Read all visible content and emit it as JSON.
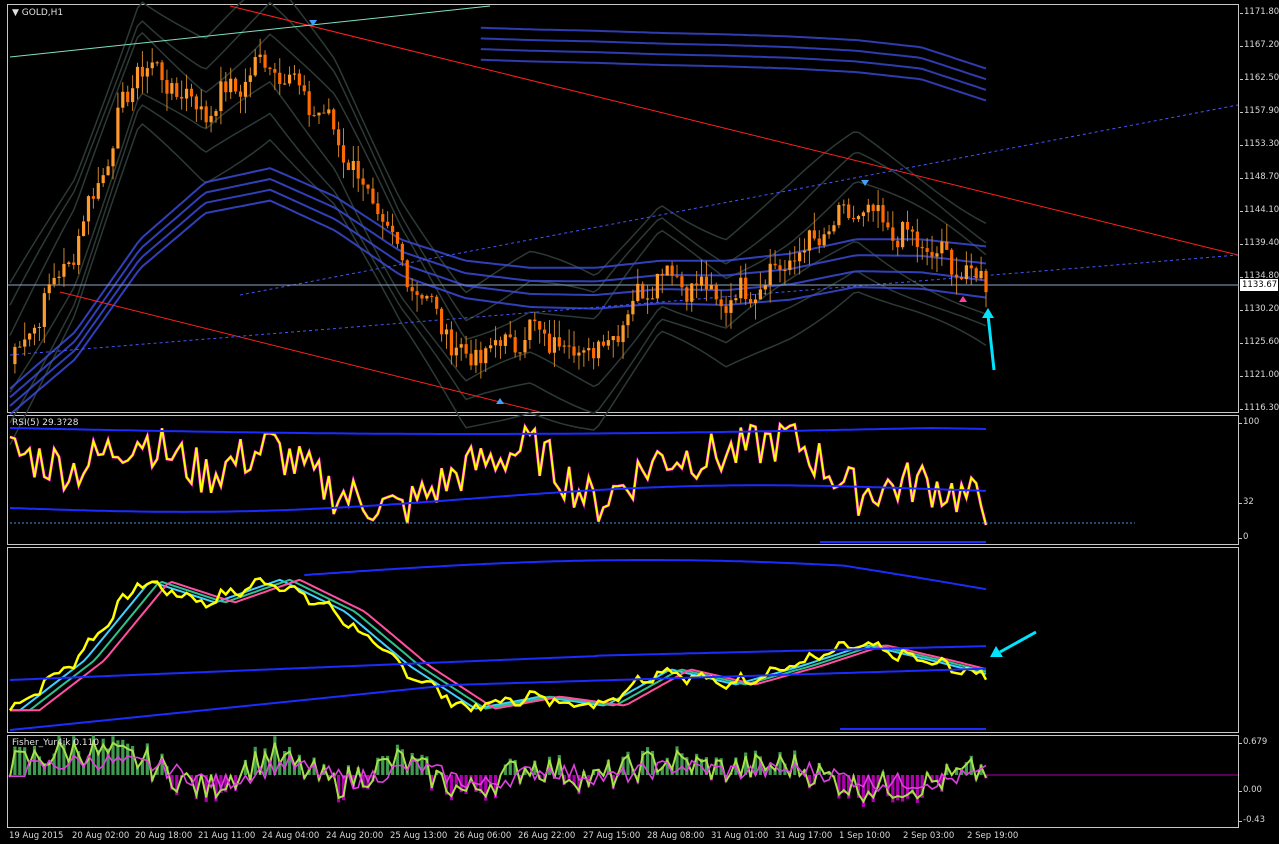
{
  "window": {
    "title": "GOLD,H1"
  },
  "colors": {
    "up_candle": "#ff9a2c",
    "down_candle": "#ff6a00",
    "trend": "#ff2020",
    "channel": "#3a4bd8",
    "rsi": "#ffff00",
    "signal": "#ff00ff",
    "histogram_up": "#3f9a4f",
    "histogram_down": "#b000b0",
    "arrow": "#00e5ff"
  },
  "price_pane": {
    "current_price": "1133.67",
    "ticks": [
      "1171.80",
      "1167.20",
      "1162.50",
      "1157.90",
      "1153.30",
      "1148.70",
      "1144.10",
      "1139.40",
      "1134.80",
      "1130.20",
      "1125.60",
      "1121.00",
      "1116.30"
    ]
  },
  "rsi_pane": {
    "label": "RSI(5) 29.3?28",
    "ticks": [
      "100",
      "32",
      "0"
    ]
  },
  "fisher_pane": {
    "label": "Fisher_Yur4ik 0.110",
    "ticks": [
      "0.679",
      "0.00",
      "-0.43"
    ]
  },
  "time_axis": [
    "19 Aug 2015",
    "20 Aug 02:00",
    "20 Aug 18:00",
    "21 Aug 11:00",
    "24 Aug 04:00",
    "24 Aug 20:00",
    "25 Aug 13:00",
    "26 Aug 06:00",
    "26 Aug 22:00",
    "27 Aug 15:00",
    "28 Aug 08:00",
    "31 Aug 01:00",
    "31 Aug 17:00",
    "1 Sep 10:00",
    "2 Sep 03:00",
    "2 Sep 19:00"
  ],
  "chart_data": [
    {
      "type": "line",
      "title": "GOLD,H1",
      "x": [
        "19 Aug 2015",
        "20 Aug 02:00",
        "20 Aug 18:00",
        "21 Aug 11:00",
        "24 Aug 04:00",
        "24 Aug 20:00",
        "25 Aug 13:00",
        "26 Aug 06:00",
        "26 Aug 22:00",
        "27 Aug 15:00",
        "28 Aug 08:00",
        "31 Aug 01:00",
        "31 Aug 17:00",
        "1 Sep 10:00",
        "2 Sep 03:00",
        "2 Sep 19:00"
      ],
      "series": [
        {
          "values": [
            1122.5,
            1139.0,
            1165.0,
            1158.0,
            1165.5,
            1155.0,
            1137.0,
            1123.0,
            1127.0,
            1124.0,
            1136.0,
            1131.0,
            1137.0,
            1144.0,
            1139.0,
            1133.67
          ]
        }
      ],
      "ylim": [
        1116.3,
        1171.8
      ]
    },
    {
      "type": "line",
      "title": "RSI(5) 29.3?28",
      "series": [
        {
          "values": [
            75,
            60,
            88,
            55,
            80,
            40,
            25,
            60,
            80,
            30,
            70,
            72,
            88,
            40,
            50,
            30
          ]
        }
      ],
      "ylim": [
        0,
        100
      ]
    },
    {
      "type": "bar",
      "title": "Fisher_Yur4ik 0.110",
      "series": [
        {
          "values": [
            0.2,
            0.5,
            0.3,
            -0.3,
            0.4,
            -0.2,
            0.3,
            -0.35,
            0.2,
            -0.1,
            0.3,
            0.1,
            0.2,
            -0.25,
            -0.2,
            0.11
          ]
        }
      ],
      "ylim": [
        -0.43,
        0.679
      ]
    }
  ]
}
